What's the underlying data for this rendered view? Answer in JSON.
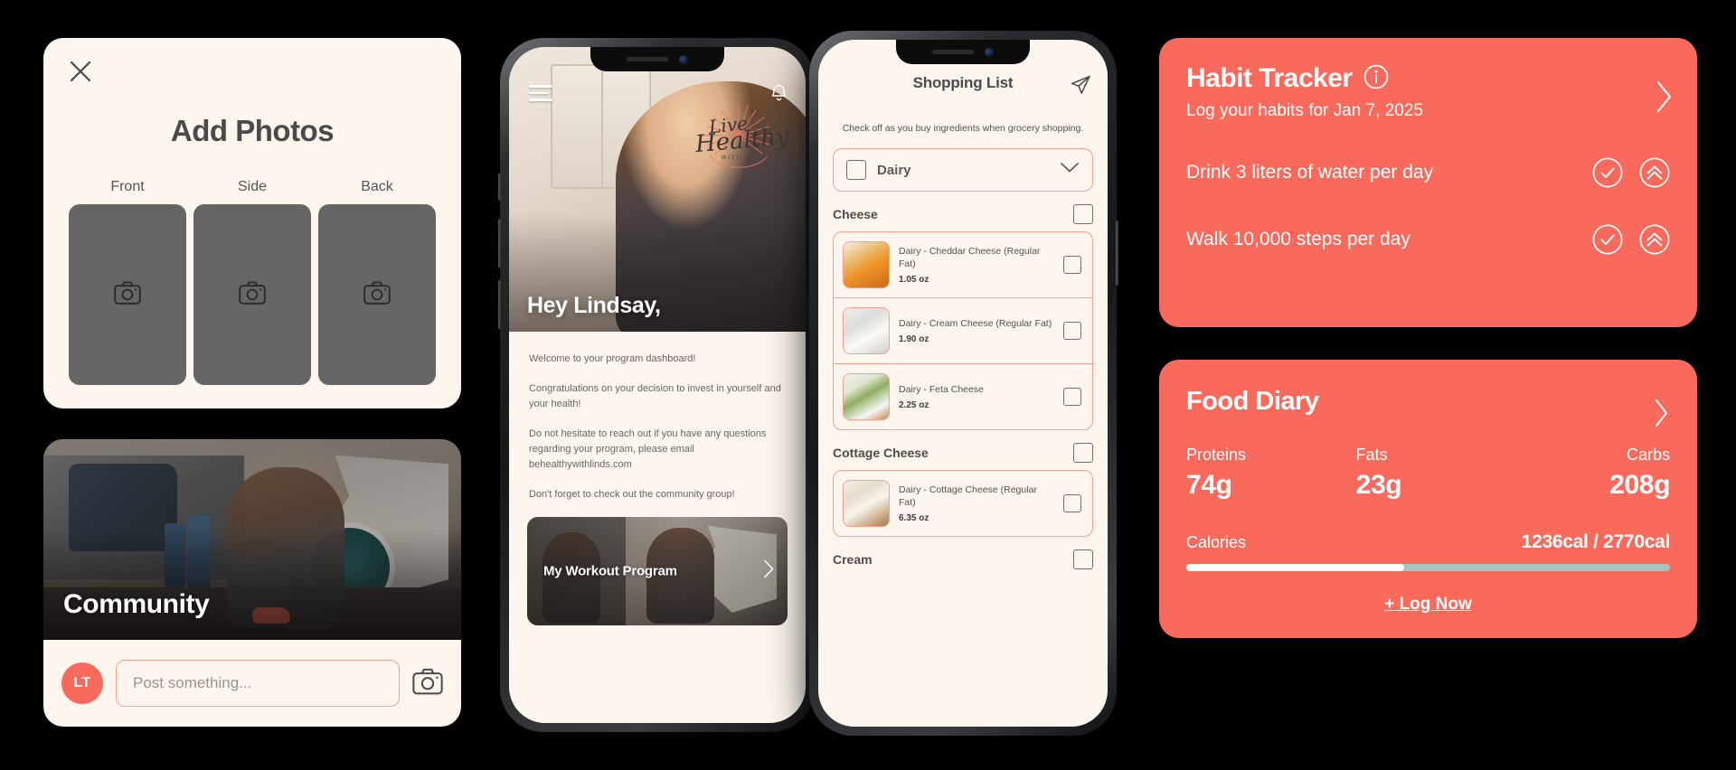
{
  "theme": {
    "coral": "#F96A5C",
    "cream": "#FDF6EF",
    "track": "#A9C2C2",
    "slot_gray": "#666666"
  },
  "add_photos": {
    "title": "Add Photos",
    "close_icon": "close-icon",
    "slots": [
      {
        "label": "Front",
        "icon": "camera-icon"
      },
      {
        "label": "Side",
        "icon": "camera-icon"
      },
      {
        "label": "Back",
        "icon": "camera-icon"
      }
    ]
  },
  "community": {
    "title": "Community",
    "avatar_initials": "LT",
    "post_placeholder": "Post something...",
    "post_value": "",
    "camera_icon": "camera-icon"
  },
  "phone_dashboard": {
    "menu_icon": "hamburger-menu-icon",
    "bell_icon": "bell-icon",
    "logo": {
      "line1": "Live",
      "line2": "Healthy",
      "line3": "WITH LINDS"
    },
    "greeting": "Hey Lindsay,",
    "paragraphs": [
      "Welcome to your program dashboard!",
      "Congratulations on your decision to invest in yourself and your health!",
      "Do not hesitate to reach out if you have any questions regarding your program, please email behealthywithlinds.com",
      "Don't forget to check out the community group!"
    ],
    "workout_card": {
      "label": "My Workout Program",
      "chevron_icon": "chevron-right-icon"
    }
  },
  "phone_shopping": {
    "title": "Shopping List",
    "send_icon": "paper-plane-icon",
    "subtitle": "Check off as you buy ingredients when grocery shopping.",
    "category": {
      "name": "Dairy",
      "chevron_icon": "chevron-down-icon",
      "checked": false
    },
    "groups": [
      {
        "heading": "Cheese",
        "checked": false,
        "items": [
          {
            "name": "Dairy - Cheddar Cheese (Regular Fat)",
            "qty": "1.05 oz",
            "thumb": "thumb-cheddar",
            "checked": false
          },
          {
            "name": "Dairy - Cream Cheese (Regular Fat)",
            "qty": "1.90 oz",
            "thumb": "thumb-cream",
            "checked": false
          },
          {
            "name": "Dairy - Feta Cheese",
            "qty": "2.25 oz",
            "thumb": "thumb-feta",
            "checked": false
          }
        ]
      },
      {
        "heading": "Cottage Cheese",
        "checked": false,
        "items": [
          {
            "name": "Dairy - Cottage Cheese (Regular Fat)",
            "qty": "6.35 oz",
            "thumb": "thumb-cottage",
            "checked": false
          }
        ]
      },
      {
        "heading": "Cream",
        "checked": false,
        "items": []
      }
    ]
  },
  "habit_tracker": {
    "title": "Habit Tracker",
    "info_icon": "info-icon",
    "chevron_icon": "chevron-right-icon",
    "subtitle": "Log your habits for Jan 7, 2025",
    "habits": [
      {
        "label": "Drink 3 liters of water per day",
        "check_icon": "check-circle-icon",
        "boost_icon": "double-chevron-up-circle-icon"
      },
      {
        "label": "Walk 10,000 steps per day",
        "check_icon": "check-circle-icon",
        "boost_icon": "double-chevron-up-circle-icon"
      }
    ]
  },
  "food_diary": {
    "title": "Food Diary",
    "chevron_icon": "chevron-right-icon",
    "macros": [
      {
        "label": "Proteins",
        "value": "74g"
      },
      {
        "label": "Fats",
        "value": "23g"
      },
      {
        "label": "Carbs",
        "value": "208g"
      }
    ],
    "calories_label": "Calories",
    "calories_value": "1236cal / 2770cal",
    "calories_consumed": 1236,
    "calories_goal": 2770,
    "calories_percent": 45,
    "log_now_label": "+ Log Now"
  }
}
